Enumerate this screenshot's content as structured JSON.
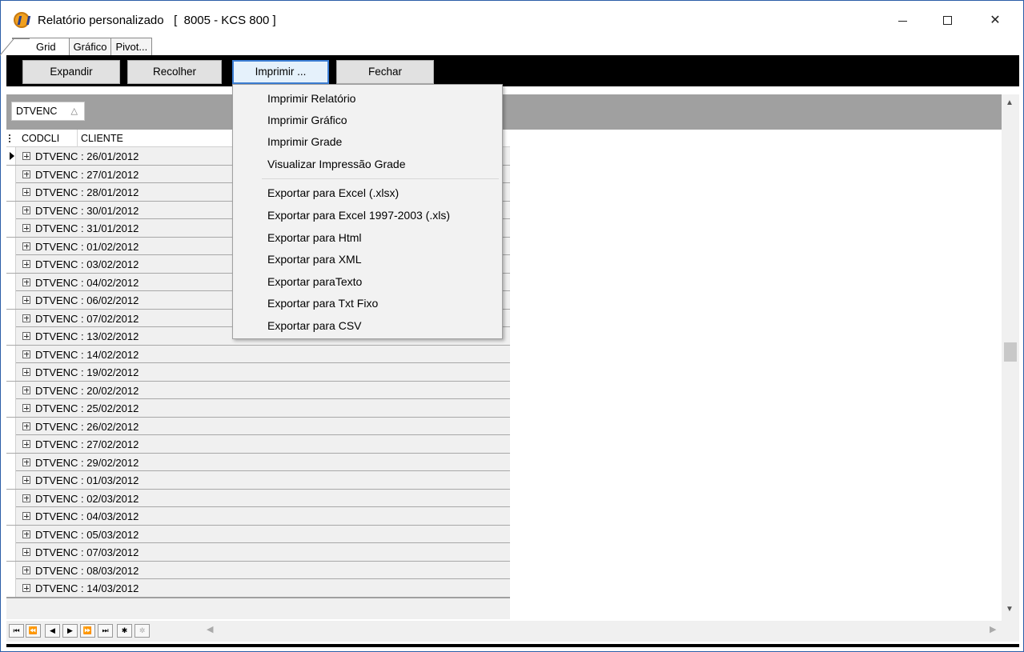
{
  "window": {
    "title": "Relatório personalizado   [  8005 - KCS 800 ]",
    "minimize_label": "–",
    "maximize_label": "□",
    "close_label": "✕"
  },
  "tabs": [
    "Grid",
    "Gráfico",
    "Pivot..."
  ],
  "toolbar": {
    "expand": "Expandir",
    "collapse": "Recolher",
    "print": "Imprimir ...",
    "close": "Fechar"
  },
  "group_panel": {
    "chip_label": "DTVENC",
    "sort_glyph": "△"
  },
  "grid": {
    "columns": [
      "CODCLI",
      "CLIENTE"
    ],
    "row_prefix": "DTVENC : ",
    "rows": [
      "26/01/2012",
      "27/01/2012",
      "28/01/2012",
      "30/01/2012",
      "31/01/2012",
      "01/02/2012",
      "03/02/2012",
      "04/02/2012",
      "06/02/2012",
      "07/02/2012",
      "13/02/2012",
      "14/02/2012",
      "19/02/2012",
      "20/02/2012",
      "25/02/2012",
      "26/02/2012",
      "27/02/2012",
      "29/02/2012",
      "01/03/2012",
      "02/03/2012",
      "04/03/2012",
      "05/03/2012",
      "07/03/2012",
      "08/03/2012",
      "14/03/2012"
    ]
  },
  "navigator": [
    "⏮",
    "⏪",
    "◀",
    "▶",
    "⏩",
    "⏭",
    "✱",
    "✲"
  ],
  "print_menu": {
    "group1": [
      "Imprimir Relatório",
      "Imprimir Gráfico",
      "Imprimir Grade",
      "Visualizar Impressão Grade"
    ],
    "group2": [
      "Exportar para Excel  (.xlsx)",
      "Exportar para Excel 1997-2003 (.xls)",
      "Exportar para Html",
      "Exportar para XML",
      "Exportar paraTexto",
      "Exportar para Txt Fixo",
      "Exportar para CSV"
    ]
  },
  "colors": {
    "toolbar_bg": "#000000",
    "group_bar_bg": "#a0a0a0",
    "focus_border": "#3c7fd6"
  }
}
